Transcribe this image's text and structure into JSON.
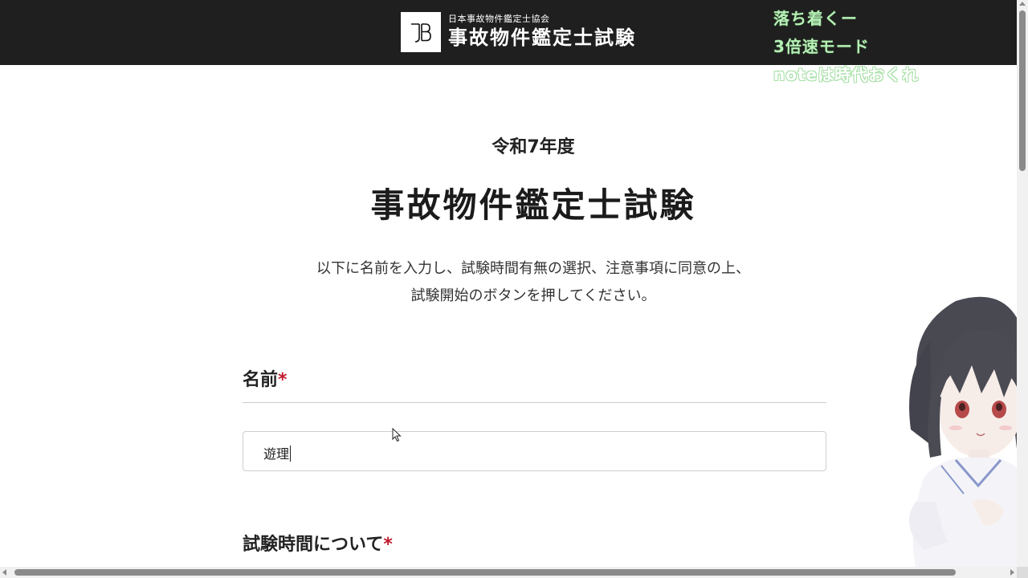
{
  "header": {
    "logo_letters": "JB",
    "org_name": "日本事故物件鑑定士協会",
    "site_name": "事故物件鑑定士試験",
    "background_color": "#1f1f1f"
  },
  "overlay_captions": {
    "line1": "落ち着くー",
    "line2": "3倍速モード",
    "line3": "noteは時代おくれ"
  },
  "main": {
    "fiscal_year": "令和7年度",
    "exam_title": "事故物件鑑定士試験",
    "instructions_line1": "以下に名前を入力し、試験時間有無の選択、注意事項に同意の上、",
    "instructions_line2": "試験開始のボタンを押してください。"
  },
  "form": {
    "name_label": "名前",
    "required_mark": "*",
    "name_value": "遊理",
    "exam_time_label": "試験時間について",
    "required_color": "#c0192b"
  },
  "icons": {
    "cursor": "mouse-pointer-icon",
    "character": "anime-girl-illustration"
  }
}
